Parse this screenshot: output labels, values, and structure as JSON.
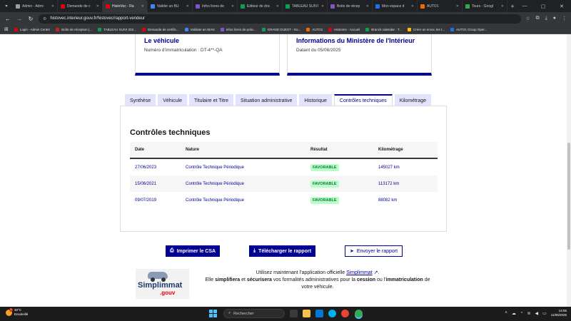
{
  "browser": {
    "tabs": [
      {
        "title": "Admin - Admi",
        "color": "#9aa0a6",
        "active": false
      },
      {
        "title": "Demande de c",
        "color": "#e1000f",
        "active": false
      },
      {
        "title": "HistoVec - Ra",
        "color": "#e1000f",
        "active": true
      },
      {
        "title": "Valider un BU",
        "color": "#4285f4",
        "active": false
      },
      {
        "title": "Infos livres de",
        "color": "#7e57c2",
        "active": false
      },
      {
        "title": "Éditeur de doc",
        "color": "#0f9d58",
        "active": false
      },
      {
        "title": "TABLEAU SUIVI",
        "color": "#0f9d58",
        "active": false
      },
      {
        "title": "Boite de récep",
        "color": "#7e57c2",
        "active": false
      },
      {
        "title": "Mon espace d",
        "color": "#1a73e8",
        "active": false
      },
      {
        "title": "AUTO1",
        "color": "#f06a00",
        "active": false
      },
      {
        "title": "Tours - Googl",
        "color": "#34a853",
        "active": false
      }
    ],
    "url": "histovec.interieur.gouv.fr/histovec/rapport-vendeur",
    "bookmarks": [
      {
        "label": "Login - Admin Center",
        "color": "#e1000f"
      },
      {
        "label": "Boîte de réception (...",
        "color": "#c5221f"
      },
      {
        "label": "TABLEAU SUIVI 202...",
        "color": "#0f9d58"
      },
      {
        "label": "Demande de certific...",
        "color": "#e1000f"
      },
      {
        "label": "Validate an IBAN",
        "color": "#4285f4"
      },
      {
        "label": "Infos livres de polic...",
        "color": "#7e57c2"
      },
      {
        "label": "GRAND OUEST - Go...",
        "color": "#0f9d58"
      },
      {
        "label": "AUTO1",
        "color": "#f06a00"
      },
      {
        "label": "HistoVec - Accueil",
        "color": "#e1000f"
      },
      {
        "label": "Branch calendar - T...",
        "color": "#0f9d58"
      },
      {
        "label": "Créer un envoi, les t...",
        "color": "#f7c300"
      },
      {
        "label": "AUTO1 Group Oper...",
        "color": "#1a73e8"
      }
    ]
  },
  "cards": {
    "vehicle": {
      "title": "Le véhicule",
      "text": "Numéro d'immatriculation : DT-4**-QA"
    },
    "ministry": {
      "title": "Informations du Ministère de l'Intérieur",
      "text": "Datant du 05/06/2025"
    }
  },
  "page_tabs": [
    "Synthèse",
    "Véhicule",
    "Titulaire et Titre",
    "Situation administrative",
    "Historique",
    "Contrôles techniques",
    "Kilométrage"
  ],
  "section": {
    "title": "Contrôles techniques",
    "columns": [
      "Date",
      "Nature",
      "Résultat",
      "Kilométrage"
    ],
    "rows": [
      {
        "date": "27/06/2023",
        "nature": "Contrôle Technique Périodique",
        "result": "FAVORABLE",
        "km": "145027 km"
      },
      {
        "date": "15/06/2021",
        "nature": "Contrôle Technique Périodique",
        "result": "FAVORABLE",
        "km": "113172 km"
      },
      {
        "date": "09/07/2019",
        "nature": "Contrôle Technique Périodique",
        "result": "FAVORABLE",
        "km": "88082 km"
      }
    ]
  },
  "actions": {
    "print": "Imprimer le CSA",
    "download": "Télécharger le rapport",
    "send": "Envoyer le rapport"
  },
  "promo": {
    "logo_main": "Simplimmat",
    "logo_sub": ".gouv",
    "line1_pre": "Utilisez maintenant l'application officielle",
    "link": "Simplimmat",
    "line2_a": "Elle",
    "bold1": "simplifiera",
    "line2_b": "et",
    "bold2": "sécurisera",
    "line2_c": "vos formalités administratives pour la",
    "bold3": "cession",
    "line2_d": "ou l'",
    "bold4": "immatriculation",
    "line2_e": "de votre véhicule."
  },
  "taskbar": {
    "temp": "30°C",
    "weather": "Ensoleillé",
    "weather_badge": "1",
    "search_placeholder": "Rechercher",
    "time": "14:55",
    "date": "11/06/2025"
  }
}
